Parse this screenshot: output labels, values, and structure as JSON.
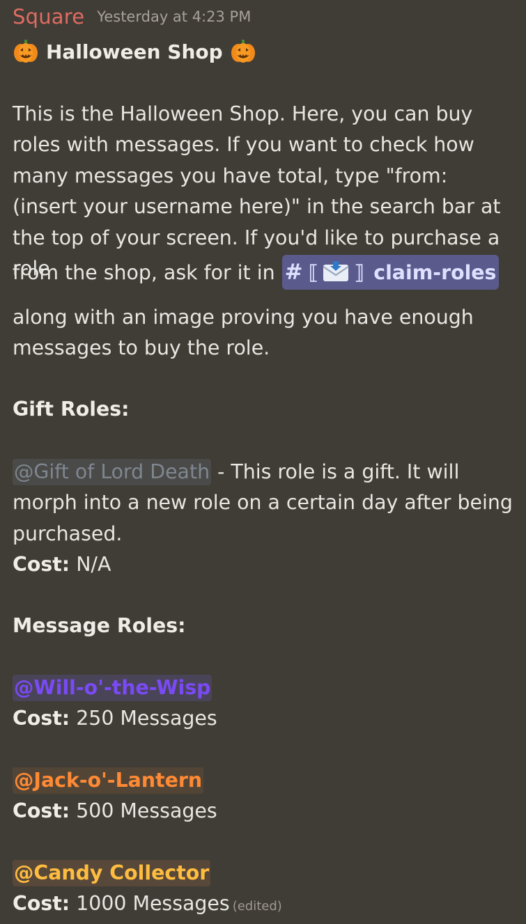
{
  "message": {
    "author": "Square",
    "timestamp": "Yesterday at 4:23 PM",
    "title": "Halloween Shop",
    "title_emoji": "jack-o-lantern",
    "intro": "This is the Halloween Shop. Here, you can buy roles with messages. If you want to check how many messages you have total, type \"from: (insert your username here)\" in the search bar at the top of your screen. If you'd like to purchase a role",
    "channel_prefix": "from the shop, ask for it in",
    "channel": {
      "hash": "#",
      "emoji": "incoming-envelope",
      "name": "claim-roles",
      "bracket_left": "⟦",
      "bracket_right": "⟧"
    },
    "after_channel": "along with an image proving you have enough messages to buy the role.",
    "gift_heading": "Gift Roles:",
    "gift_role": {
      "mention": "@Gift of Lord Death",
      "description": " - This role is a gift. It will morph into a new role on a certain day after being purchased.",
      "cost_label": "Cost:",
      "cost_value": " N/A"
    },
    "message_heading": "Message Roles:",
    "message_roles": [
      {
        "mention": "@Will-o'-the-Wisp",
        "cost_label": "Cost:",
        "cost_value": " 250 Messages"
      },
      {
        "mention": "@Jack-o'-Lantern",
        "cost_label": "Cost:",
        "cost_value": " 500 Messages"
      },
      {
        "mention": "@Candy Collector",
        "cost_label": "Cost:",
        "cost_value": " 1000 Messages"
      }
    ],
    "edited": "(edited)"
  },
  "colors": {
    "background": "#403d36",
    "author": "#e06c62",
    "channel_mention_bg": "#5a5a8d",
    "wisp": "#7a4af6",
    "jack": "#ff8a35",
    "candy": "#ffbd3f",
    "death": "#7f8790"
  }
}
